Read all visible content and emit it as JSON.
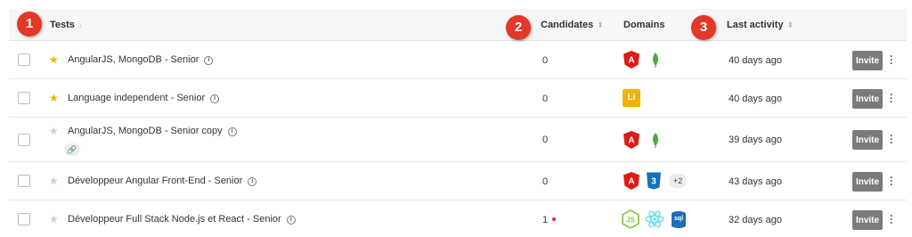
{
  "header": {
    "tests": "Tests",
    "candidates": "Candidates",
    "domains": "Domains",
    "last_activity": "Last activity"
  },
  "badges": [
    "1",
    "2",
    "3"
  ],
  "rows": [
    {
      "favorite": true,
      "name": "AngularJS, MongoDB - Senior",
      "candidates": "0",
      "new_dot": false,
      "domains": [
        "angular-icon",
        "mongodb-icon"
      ],
      "domain_more": "",
      "last_activity": "40 days ago",
      "invite": "Invite"
    },
    {
      "favorite": true,
      "name": "Language independent - Senior",
      "candidates": "0",
      "new_dot": false,
      "domains": [
        "language-independent-icon"
      ],
      "domain_label": "Li",
      "domain_more": "",
      "last_activity": "40 days ago",
      "invite": "Invite"
    },
    {
      "favorite": false,
      "name": "AngularJS, MongoDB - Senior copy",
      "candidates": "0",
      "new_dot": false,
      "domains": [
        "angular-icon",
        "mongodb-icon"
      ],
      "domain_more": "",
      "last_activity": "39 days ago",
      "invite": "Invite",
      "has_link": true
    },
    {
      "favorite": false,
      "name": "Développeur Angular Front-End - Senior",
      "candidates": "0",
      "new_dot": false,
      "domains": [
        "angular-icon",
        "css3-icon"
      ],
      "domain_more": "+2",
      "last_activity": "43 days ago",
      "invite": "Invite"
    },
    {
      "favorite": false,
      "name": "Développeur Full Stack Node.js et React - Senior",
      "candidates": "1",
      "new_dot": true,
      "domains": [
        "nodejs-icon",
        "react-icon",
        "sql-icon"
      ],
      "domain_label": "sql",
      "domain_more": "",
      "last_activity": "32 days ago",
      "invite": "Invite"
    }
  ],
  "colors": {
    "badge": "#e2382a",
    "star_on": "#f0b400",
    "invite_bg": "#7b7b7b",
    "angular": "#dd1b16",
    "mongodb": "#4faa41",
    "css3": "#1572b6",
    "nodejs": "#8cc84b",
    "react": "#61dafb",
    "sql": "#1e6fb8",
    "language_independent": "#f0b400"
  }
}
